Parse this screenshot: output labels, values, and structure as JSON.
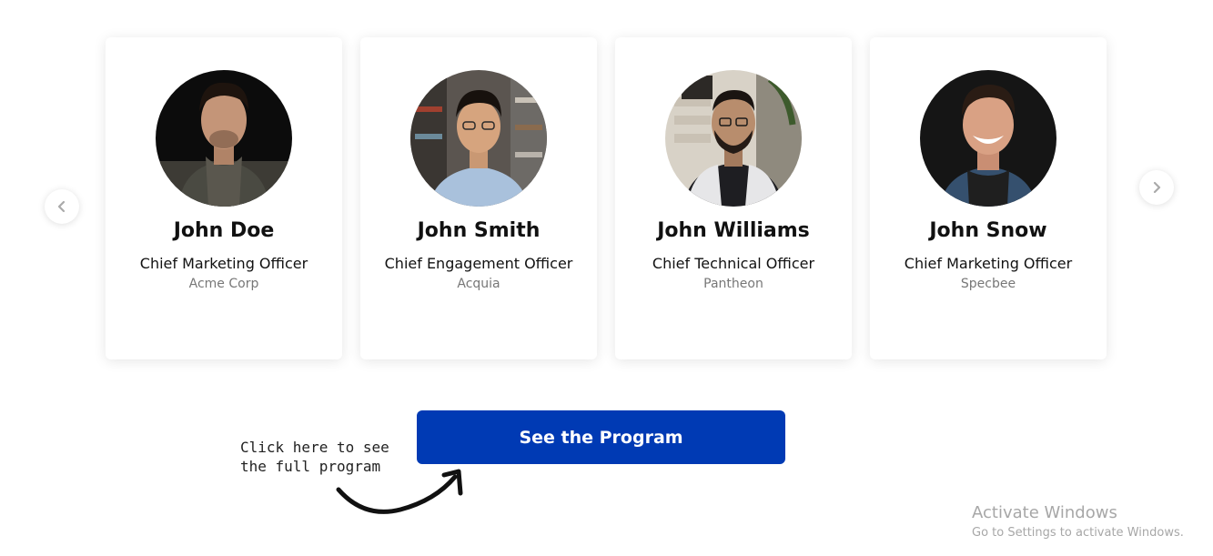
{
  "speakers": [
    {
      "name": "John Doe",
      "role": "Chief Marketing Officer",
      "company": "Acme Corp"
    },
    {
      "name": "John Smith",
      "role": "Chief Engagement Officer",
      "company": "Acquia"
    },
    {
      "name": "John Williams",
      "role": "Chief Technical Officer",
      "company": "Pantheon"
    },
    {
      "name": "John Snow",
      "role": "Chief Marketing Officer",
      "company": "Specbee"
    }
  ],
  "carousel": {
    "prev_icon": "chevron-left-icon",
    "next_icon": "chevron-right-icon"
  },
  "cta": {
    "label": "See the Program",
    "color": "#003ab4"
  },
  "hint": {
    "line1": "Click here to see",
    "line2": "the full program"
  },
  "watermark": {
    "title": "Activate Windows",
    "subtitle": "Go to Settings to activate Windows."
  }
}
